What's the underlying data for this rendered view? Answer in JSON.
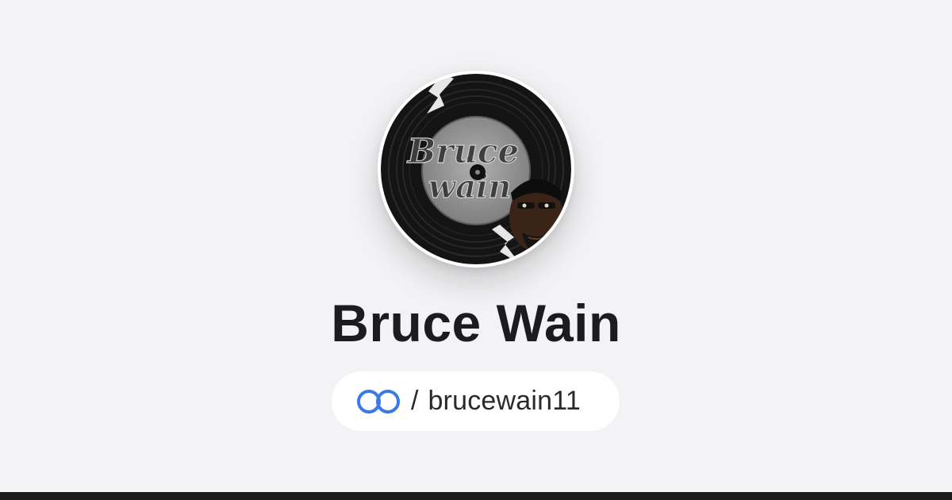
{
  "profile": {
    "name": "Bruce Wain",
    "avatar_logo_text": "Bruce Wain",
    "avatar_icon": "vinyl-record-avatar"
  },
  "handle": {
    "separator": "/",
    "username": "brucewain11",
    "brand_icon": "linked-rings-logo-icon"
  },
  "colors": {
    "background": "#f3f3f5",
    "name_text": "#1c1c1e",
    "brand_blue": "#3b79e6",
    "bottom_bar": "#1b1b1c"
  }
}
